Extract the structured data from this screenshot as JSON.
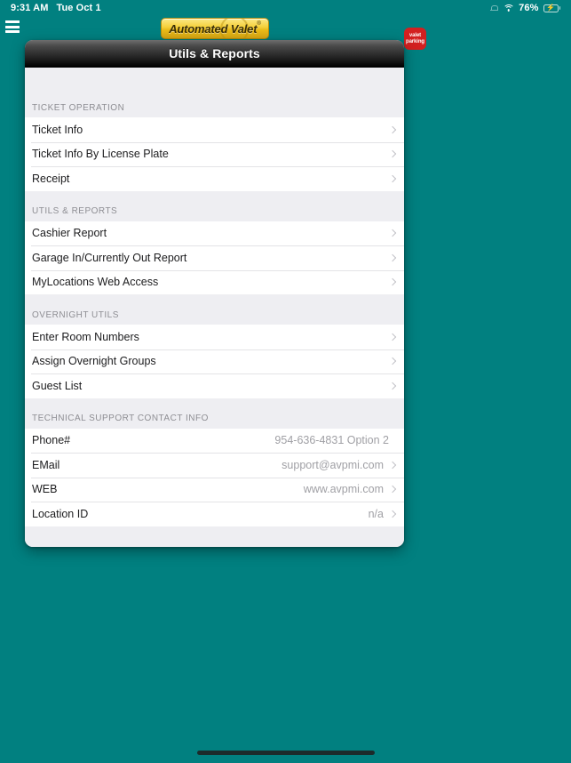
{
  "status_bar": {
    "time": "9:31 AM",
    "date": "Tue Oct 1",
    "battery_percent": "76%",
    "icons": {
      "bell": "bell-icon",
      "wifi": "wifi-icon",
      "battery": "battery-charging-icon"
    }
  },
  "app_bar": {
    "menu_icon": "hamburger-menu-icon",
    "brand_logo_text": "Automated Valet",
    "brand_logo_tm": "®",
    "valet_badge_line1": "valet",
    "valet_badge_line2": "parking"
  },
  "card": {
    "header_title": "Utils & Reports"
  },
  "sections": [
    {
      "title": "TICKET OPERATION",
      "rows": [
        {
          "label": "Ticket Info",
          "value": "",
          "chevron": true
        },
        {
          "label": "Ticket Info By License Plate",
          "value": "",
          "chevron": true
        },
        {
          "label": "Receipt",
          "value": "",
          "chevron": true
        }
      ]
    },
    {
      "title": "UTILS & REPORTS",
      "rows": [
        {
          "label": "Cashier Report",
          "value": "",
          "chevron": true
        },
        {
          "label": "Garage In/Currently Out Report",
          "value": "",
          "chevron": true
        },
        {
          "label": "MyLocations Web Access",
          "value": "",
          "chevron": true
        }
      ]
    },
    {
      "title": "OVERNIGHT UTILS",
      "rows": [
        {
          "label": "Enter Room Numbers",
          "value": "",
          "chevron": true
        },
        {
          "label": "Assign Overnight Groups",
          "value": "",
          "chevron": true
        },
        {
          "label": "Guest List",
          "value": "",
          "chevron": true
        }
      ]
    },
    {
      "title": "TECHNICAL SUPPORT CONTACT INFO",
      "rows": [
        {
          "label": "Phone#",
          "value": "954-636-4831 Option 2",
          "chevron": false
        },
        {
          "label": "EMail",
          "value": "support@avpmi.com",
          "chevron": true
        },
        {
          "label": "WEB",
          "value": "www.avpmi.com",
          "chevron": true
        },
        {
          "label": "Location ID",
          "value": "n/a",
          "chevron": true
        }
      ]
    }
  ],
  "colors": {
    "background_teal": "#018080",
    "card_background": "#eeeef2",
    "row_background": "#ffffff",
    "brand_yellow": "#f5d13c",
    "valet_badge_red": "#d32020",
    "section_title_gray": "#8e8e93",
    "value_gray": "#a0a0a5"
  }
}
